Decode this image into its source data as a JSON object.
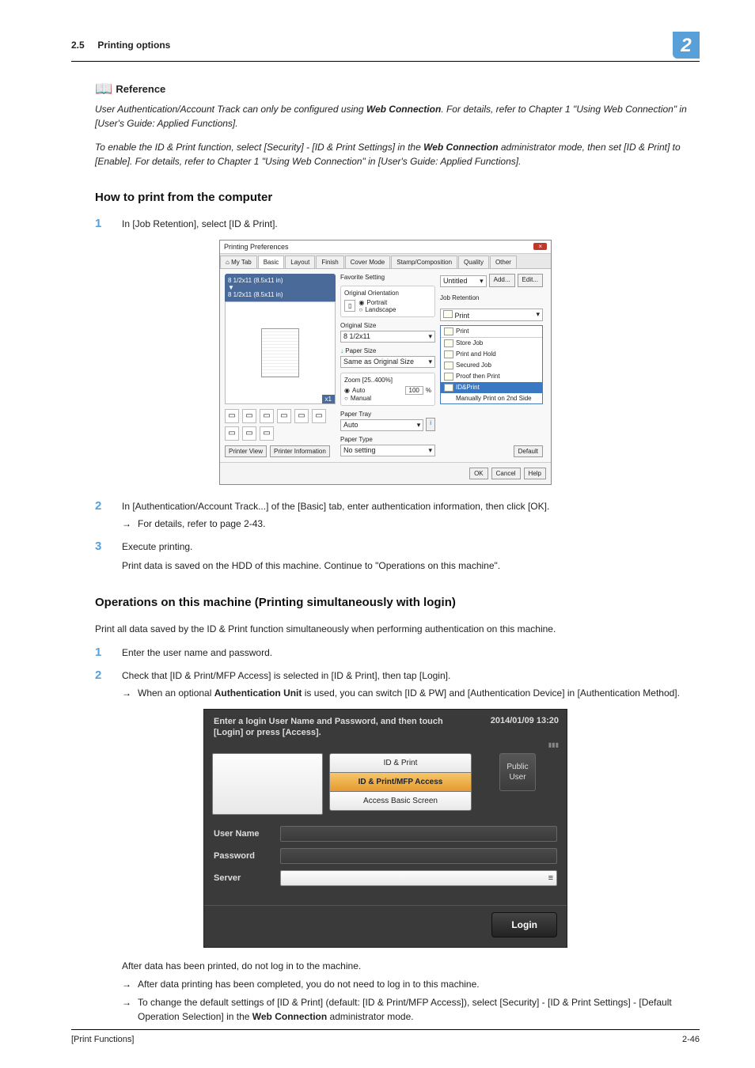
{
  "header": {
    "section": "2.5",
    "title": "Printing options",
    "chapter": "2"
  },
  "reference": {
    "label": "Reference",
    "para1_a": "User Authentication/Account Track can only be configured using ",
    "para1_bold": "Web Connection",
    "para1_b": ". For details, refer to Chapter 1 \"Using Web Connection\" in [User's Guide: Applied Functions].",
    "para2_a": "To enable the ID & Print function, select [Security] - [ID & Print Settings] in the ",
    "para2_bold": "Web Connection",
    "para2_b": " administrator mode, then set [ID & Print] to [Enable]. For details, refer to Chapter 1 \"Using Web Connection\" in [User's Guide: Applied Functions]."
  },
  "sectionA": {
    "title": "How to print from the computer",
    "step1": "In [Job Retention], select [ID & Print].",
    "step2": "In [Authentication/Account Track...] of the [Basic] tab, enter authentication information, then click [OK].",
    "step2_sub": "For details, refer to page 2-43.",
    "step3a": "Execute printing.",
    "step3b": "Print data is saved on the HDD of this machine. Continue to \"Operations on this machine\"."
  },
  "preview": {
    "windowtitle": "Printing Preferences",
    "close": "×",
    "tabs": [
      "My Tab",
      "Basic",
      "Layout",
      "Finish",
      "Cover Mode",
      "Stamp/Composition",
      "Quality",
      "Other"
    ],
    "left": {
      "dims": "8 1/2x11 (8.5x11 in)",
      "dims2": "8 1/2x11 (8.5x11 in)",
      "x1": "x1",
      "btn1": "Printer View",
      "btn2": "Printer Information"
    },
    "mid": {
      "fav_label": "Favorite Setting",
      "fav_value": "Untitled",
      "orient_title": "Original Orientation",
      "orient_icon": "▯",
      "orient_portrait": "Portrait",
      "orient_landscape": "Landscape",
      "osize_label": "Original Size",
      "osize_value": "8 1/2x11",
      "psize_label": "Paper Size",
      "psize_value": "Same as Original Size",
      "zoom_title": "Zoom [25..400%]",
      "zoom_auto": "Auto",
      "zoom_manual": "Manual",
      "zoom_value": "100",
      "zoom_pct": "%",
      "tray_label": "Paper Tray",
      "tray_value": "Auto",
      "ptype_label": "Paper Type",
      "ptype_value": "No setting",
      "info": "i"
    },
    "right": {
      "add": "Add...",
      "edit": "Edit...",
      "jr_label": "Job Retention",
      "jr_selected": "Print",
      "dropdown": [
        "Print",
        "Store Job",
        "Print and Hold",
        "Secured Job",
        "Proof then Print",
        "ID&Print",
        "Manually Print on 2nd Side"
      ]
    },
    "bottom": {
      "default": "Default",
      "ok": "OK",
      "cancel": "Cancel",
      "help": "Help"
    }
  },
  "sectionB": {
    "title": "Operations on this machine (Printing simultaneously with login)",
    "intro": "Print all data saved by the ID & Print function simultaneously when performing authentication on this machine.",
    "step1": "Enter the user name and password.",
    "step2": "Check that [ID & Print/MFP Access] is selected in [ID & Print], then tap [Login].",
    "step2_sub_a": "When an optional ",
    "step2_sub_bold": "Authentication Unit",
    "step2_sub_b": " is used, you can switch [ID & PW] and [Authentication Device] in [Authentication Method]."
  },
  "login": {
    "top_left": "Enter a login User Name and Password, and then touch [Login] or press [Access].",
    "top_right": "2014/01/09 13:20",
    "mini": "▮▮▮",
    "tab_top": "ID & Print",
    "tab_sel": "ID & Print/MFP Access",
    "tab_bot": "Access Basic Screen",
    "public": "Public\nUser",
    "username": "User Name",
    "password": "Password",
    "server": "Server",
    "srv_icon": "≡",
    "login": "Login"
  },
  "after": {
    "line1": "After data has been printed, do not log in to the machine.",
    "sub1": "After data printing has been completed, you do not need to log in to this machine.",
    "sub2_a": "To change the default settings of [ID & Print] (default: [ID & Print/MFP Access]), select [Security] - [ID & Print Settings] - [Default Operation Selection] in the ",
    "sub2_bold": "Web Connection",
    "sub2_b": " administrator mode."
  },
  "footer": {
    "left": "[Print Functions]",
    "right": "2-46"
  },
  "nums": {
    "n1": "1",
    "n2": "2",
    "n3": "3"
  },
  "glyph": {
    "arrow": "→",
    "book": "📖",
    "caret": "▾",
    "radio_on": "◉",
    "radio_off": "○",
    "plus": "↓",
    "home": "⌂"
  }
}
